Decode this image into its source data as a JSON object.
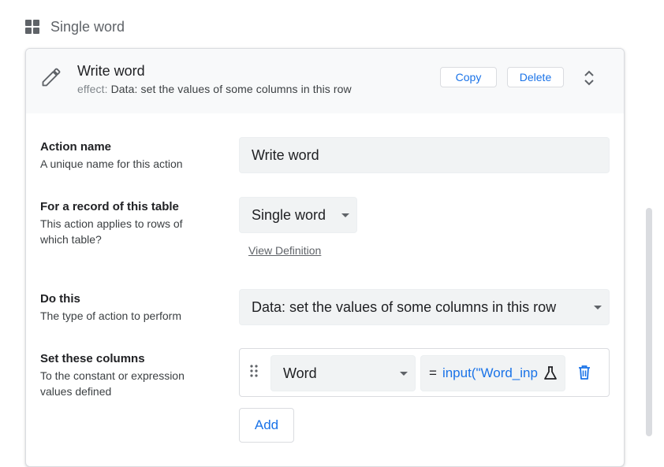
{
  "section": {
    "title": "Single word",
    "icon": "grid-icon"
  },
  "action": {
    "title": "Write word",
    "effect_prefix": "effect:",
    "effect_text": "Data: set the values of some columns in this row",
    "copy_label": "Copy",
    "delete_label": "Delete"
  },
  "fields": {
    "action_name": {
      "label": "Action name",
      "desc": "A unique name for this action",
      "value": "Write word"
    },
    "for_record": {
      "label": "For a record of this table",
      "desc": "This action applies to rows of which table?",
      "value": "Single word",
      "link": "View Definition"
    },
    "do_this": {
      "label": "Do this",
      "desc": "The type of action to perform",
      "value": "Data: set the values of some columns in this row"
    },
    "set_columns": {
      "label": "Set these columns",
      "desc": "To the constant or expression values defined",
      "rows": [
        {
          "column": "Word",
          "eq": "=",
          "expression": "input(\"Word_input\""
        }
      ],
      "add_label": "Add"
    }
  },
  "colors": {
    "accent": "#1a73e8",
    "header_bg": "#f8f9fa",
    "field_bg": "#f1f3f4",
    "border": "#dadce0"
  }
}
